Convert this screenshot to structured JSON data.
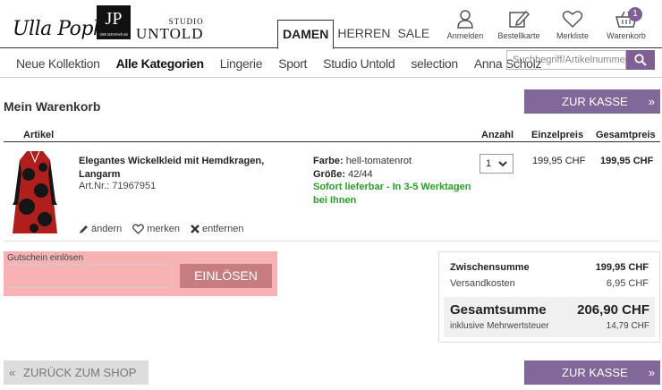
{
  "brand": {
    "ulla": "Ulla Popken",
    "jp": "JP",
    "jp_sub": "1880 MENSWEAR",
    "studio_top": "STUDIO",
    "studio_bottom": "UNTOLD"
  },
  "gender_tabs": [
    "DAMEN",
    "HERREN",
    "SALE"
  ],
  "header_icons": [
    {
      "label": "Anmelden",
      "icon": "user-icon"
    },
    {
      "label": "Bestellkarte",
      "icon": "order-card-icon"
    },
    {
      "label": "Merkliste",
      "icon": "heart-icon"
    },
    {
      "label": "Warenkorb",
      "icon": "basket-icon",
      "badge": "1"
    }
  ],
  "nav": [
    "Neue Kollektion",
    "Alle Kategorien",
    "Lingerie",
    "Sport",
    "Studio Untold",
    "selection",
    "Anna Scholz"
  ],
  "search": {
    "placeholder": "Suchbegriff/Artikelnummer"
  },
  "cart": {
    "title": "Mein Warenkorb",
    "checkout_label": "ZUR KASSE",
    "columns": {
      "article": "Artikel",
      "qty": "Anzahl",
      "unit": "Einzelpreis",
      "total": "Gesamtpreis"
    },
    "item": {
      "name": "Elegantes Wickelkleid mit Hemdkragen, Langarm",
      "art_no": "Art.Nr.: 71967951",
      "color_label": "Farbe:",
      "color_value": "hell-tomatenrot",
      "size_label": "Größe:",
      "size_value": "42/44",
      "availability": "Sofort lieferbar - In 3-5 Werktagen bei Ihnen",
      "qty": "1",
      "unit_price": "199,95 CHF",
      "total_price": "199,95 CHF",
      "actions": {
        "edit": "ändern",
        "save": "merken",
        "remove": "entfernen"
      }
    }
  },
  "coupon": {
    "label": "Gutschein einlösen",
    "button": "EINLÖSEN"
  },
  "summary": {
    "subtotal_label": "Zwischensumme",
    "subtotal_value": "199,95 CHF",
    "shipping_label": "Versandkosten",
    "shipping_value": "6,95 CHF",
    "total_label": "Gesamtsumme",
    "total_value": "206,90 CHF",
    "vat_label": "inklusive Mehrwertsteuer",
    "vat_value": "14,79 CHF"
  },
  "back_label": "ZURÜCK ZUM SHOP",
  "colors": {
    "accent": "#82689a",
    "availability": "#2aa02a",
    "coupon_highlight": "#f7b3b3"
  }
}
